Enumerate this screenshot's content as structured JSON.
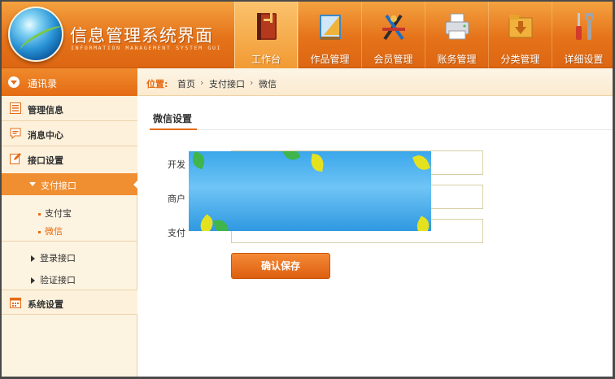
{
  "app": {
    "title": "信息管理系统界面",
    "subtitle": "INFORMATION MANAGEMENT SYSTEM GUI"
  },
  "nav": {
    "items": [
      {
        "label": "工作台",
        "icon": "ledger-book-icon",
        "active": true
      },
      {
        "label": "作品管理",
        "icon": "drawing-board-icon",
        "active": false
      },
      {
        "label": "会员管理",
        "icon": "design-tools-icon",
        "active": false
      },
      {
        "label": "账务管理",
        "icon": "printer-icon",
        "active": false
      },
      {
        "label": "分类管理",
        "icon": "download-box-icon",
        "active": false
      },
      {
        "label": "详细设置",
        "icon": "screwdriver-wrench-icon",
        "active": false
      }
    ]
  },
  "sidebar": {
    "header": "通讯录",
    "sections": [
      {
        "label": "管理信息",
        "icon": "list-icon"
      },
      {
        "label": "消息中心",
        "icon": "message-icon"
      },
      {
        "label": "接口设置",
        "icon": "edit-icon"
      }
    ],
    "active_sub": "支付接口",
    "leaves": [
      {
        "label": "支付宝",
        "active": false
      },
      {
        "label": "微信",
        "active": true
      }
    ],
    "collapsed": [
      "登录接口",
      "验证接口"
    ],
    "bottom_section": {
      "label": "系统设置",
      "icon": "calendar-icon"
    }
  },
  "breadcrumb": {
    "label": "位置:",
    "items": [
      "首页",
      "支付接口",
      "微信"
    ],
    "separator": "›"
  },
  "main": {
    "tab": "微信设置",
    "fields": [
      {
        "label": "开发",
        "value": ""
      },
      {
        "label": "商户",
        "value": ""
      },
      {
        "label": "支付",
        "value": ""
      }
    ],
    "save_label": "确认保存"
  },
  "colors": {
    "accent": "#e46b14",
    "header": "#ea7f22",
    "sidebar": "#fdf3e1"
  }
}
